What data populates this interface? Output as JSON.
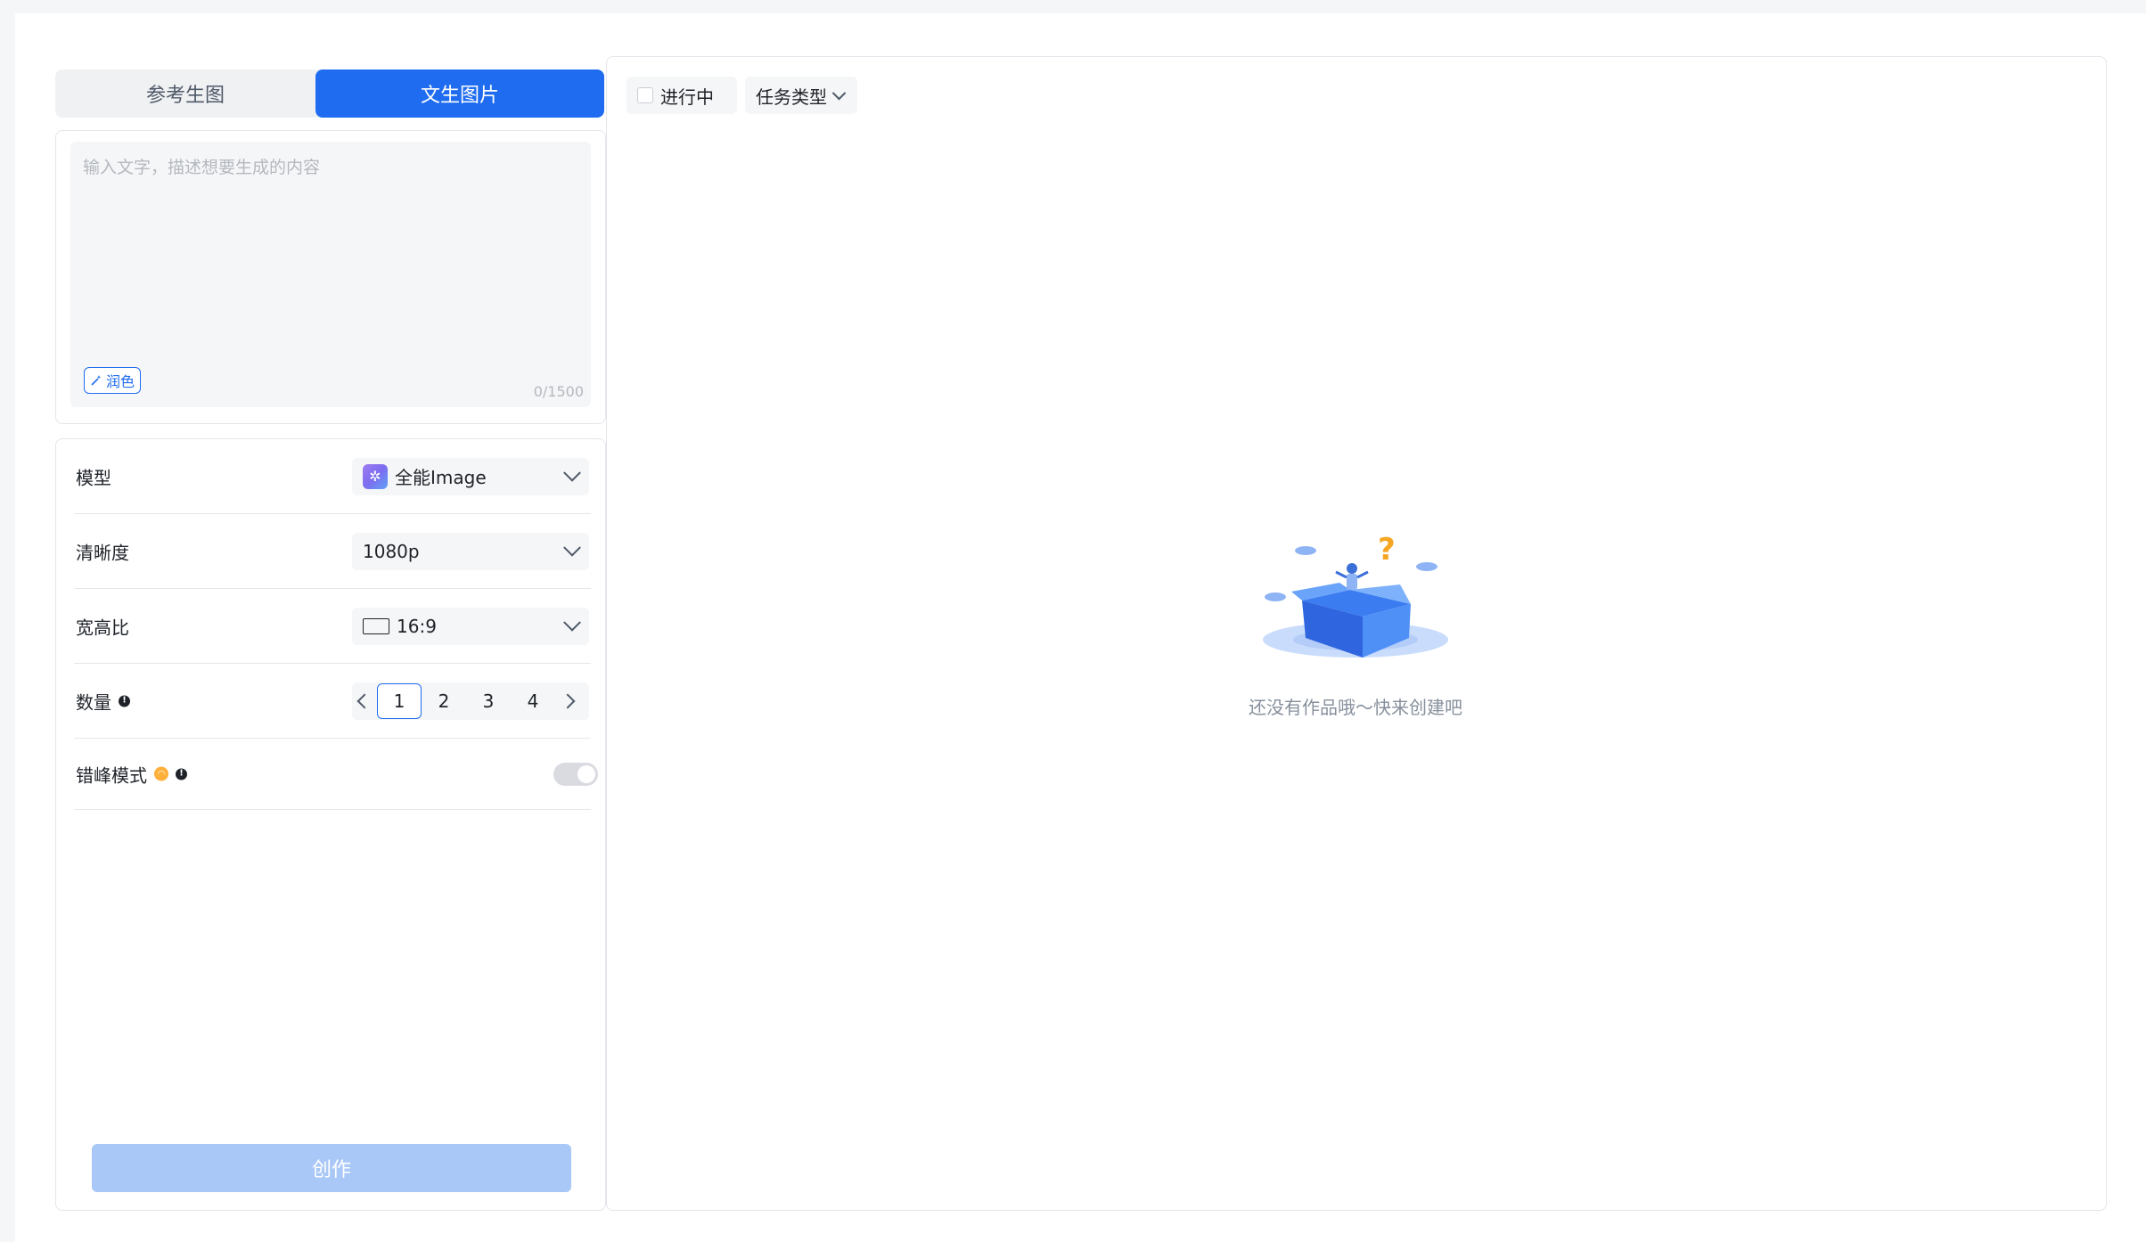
{
  "tabs": [
    {
      "label": "参考生图",
      "active": false
    },
    {
      "label": "文生图片",
      "active": true
    }
  ],
  "prompt": {
    "placeholder": "输入文字，描述想要生成的内容",
    "value": "",
    "polish_label": "润色",
    "char_count": "0/1500"
  },
  "settings": {
    "model": {
      "label": "模型",
      "value": "全能Image"
    },
    "resolution": {
      "label": "清晰度",
      "value": "1080p"
    },
    "aspect": {
      "label": "宽高比",
      "value": "16:9"
    },
    "quantity": {
      "label": "数量",
      "options": [
        "1",
        "2",
        "3",
        "4"
      ],
      "selected": "1"
    },
    "offpeak": {
      "label": "错峰模式",
      "enabled": false
    }
  },
  "create_label": "创作",
  "results": {
    "filter_ongoing": "进行中",
    "filter_tasktype": "任务类型",
    "empty_text": "还没有作品哦～快来创建吧"
  },
  "colors": {
    "accent": "#1f6cf0",
    "create_disabled": "#a9c8f7",
    "border": "#e5e6eb"
  }
}
